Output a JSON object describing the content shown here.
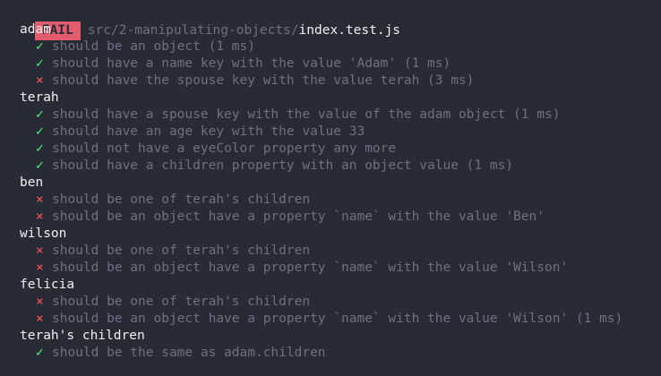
{
  "header": {
    "status": "FAIL",
    "path_dir": "src/2-manipulating-objects/",
    "path_file": "index.test.js"
  },
  "colors": {
    "background": "#282a36",
    "fail_badge": "#e05c6e",
    "pass_mark": "#50fa7b",
    "fail_mark": "#ff5555",
    "dim_text": "#6d7080",
    "bright_text": "#f1f1f1"
  },
  "marks": {
    "pass": "✓",
    "fail": "×"
  },
  "suites": [
    {
      "title": "adam",
      "tests": [
        {
          "status": "pass",
          "text": "should be an object (1 ms)"
        },
        {
          "status": "pass",
          "text": "should have a name key with the value 'Adam' (1 ms)"
        },
        {
          "status": "fail",
          "text": "should have the spouse key with the value terah (3 ms)"
        }
      ]
    },
    {
      "title": "terah",
      "tests": [
        {
          "status": "pass",
          "text": "should have a spouse key with the value of the adam object (1 ms)"
        },
        {
          "status": "pass",
          "text": "should have an age key with the value 33"
        },
        {
          "status": "pass",
          "text": "should not have a eyeColor property any more"
        },
        {
          "status": "pass",
          "text": "should have a children property with an object value (1 ms)"
        }
      ]
    },
    {
      "title": "ben",
      "tests": [
        {
          "status": "fail",
          "text": "should be one of terah's children"
        },
        {
          "status": "fail",
          "text": "should be an object have a property `name` with the value 'Ben'"
        }
      ]
    },
    {
      "title": "wilson",
      "tests": [
        {
          "status": "fail",
          "text": "should be one of terah's children"
        },
        {
          "status": "fail",
          "text": "should be an object have a property `name` with the value 'Wilson'"
        }
      ]
    },
    {
      "title": "felicia",
      "tests": [
        {
          "status": "fail",
          "text": "should be one of terah's children"
        },
        {
          "status": "fail",
          "text": "should be an object have a property `name` with the value 'Wilson' (1 ms)"
        }
      ]
    },
    {
      "title": "terah's children",
      "tests": [
        {
          "status": "pass",
          "text": "should be the same as adam.children"
        }
      ]
    }
  ]
}
